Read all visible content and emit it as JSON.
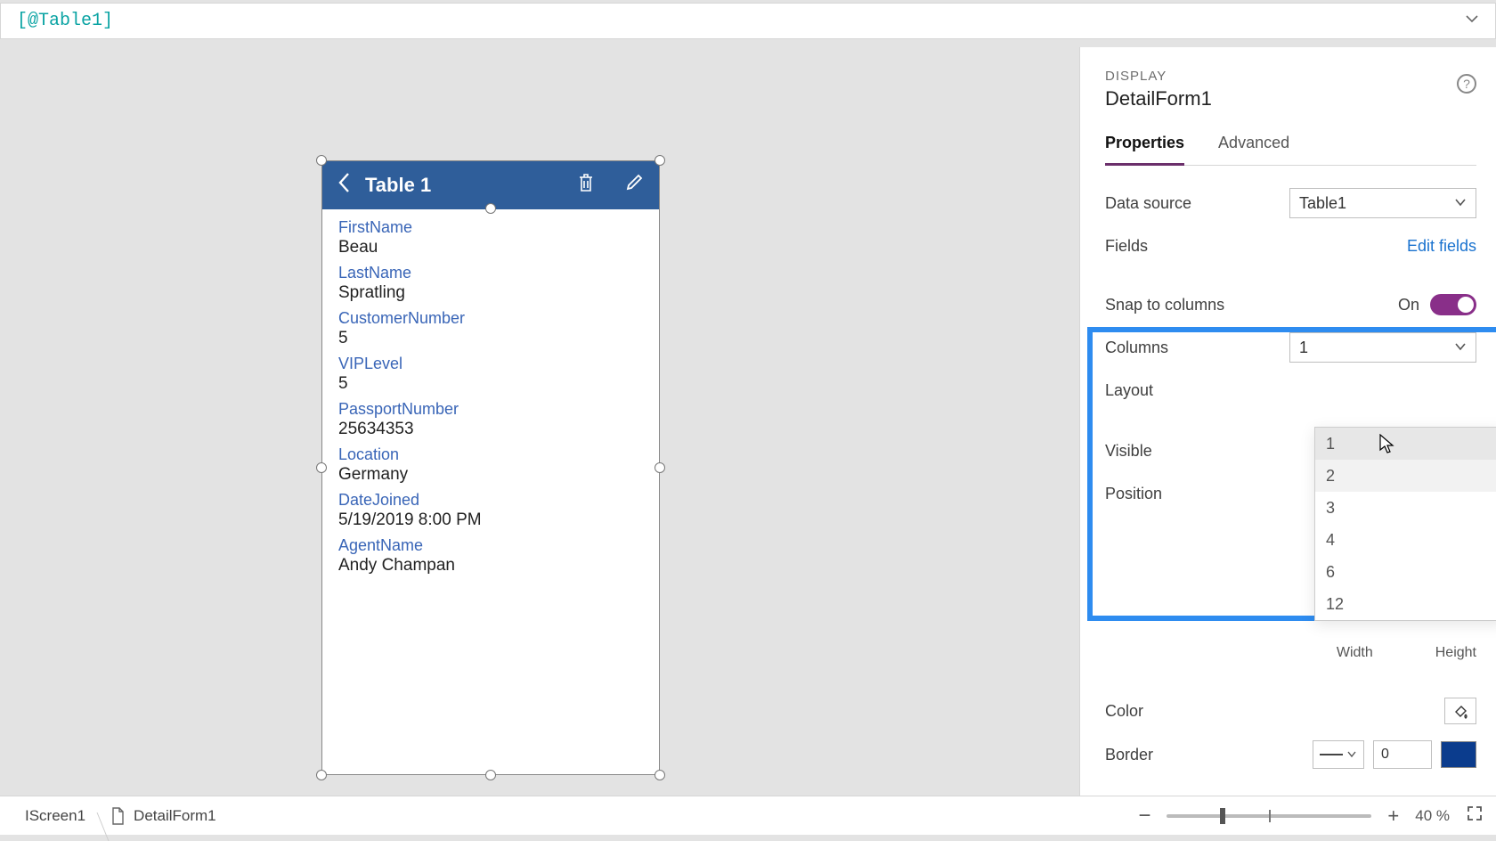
{
  "formula": "[@Table1]",
  "card": {
    "title": "Table 1",
    "fields": [
      {
        "label": "FirstName",
        "value": "Beau"
      },
      {
        "label": "LastName",
        "value": "Spratling"
      },
      {
        "label": "CustomerNumber",
        "value": "5"
      },
      {
        "label": "VIPLevel",
        "value": "5"
      },
      {
        "label": "PassportNumber",
        "value": "25634353"
      },
      {
        "label": "Location",
        "value": "Germany"
      },
      {
        "label": "DateJoined",
        "value": "5/19/2019 8:00 PM"
      },
      {
        "label": "AgentName",
        "value": "Andy Champan"
      }
    ]
  },
  "panel": {
    "category": "DISPLAY",
    "name": "DetailForm1",
    "tabs": {
      "properties": "Properties",
      "advanced": "Advanced"
    },
    "rows": {
      "data_source": "Data source",
      "data_source_value": "Table1",
      "fields": "Fields",
      "edit_fields": "Edit fields",
      "snap": "Snap to columns",
      "snap_state": "On",
      "columns": "Columns",
      "columns_value": "1",
      "layout": "Layout",
      "visible": "Visible",
      "position": "Position",
      "width": "Width",
      "height": "Height",
      "color": "Color",
      "border": "Border",
      "border_value": "0"
    },
    "dropdown": [
      "1",
      "2",
      "3",
      "4",
      "6",
      "12"
    ]
  },
  "status": {
    "crumb1": "IScreen1",
    "crumb2": "DetailForm1",
    "zoom": "40  %"
  }
}
